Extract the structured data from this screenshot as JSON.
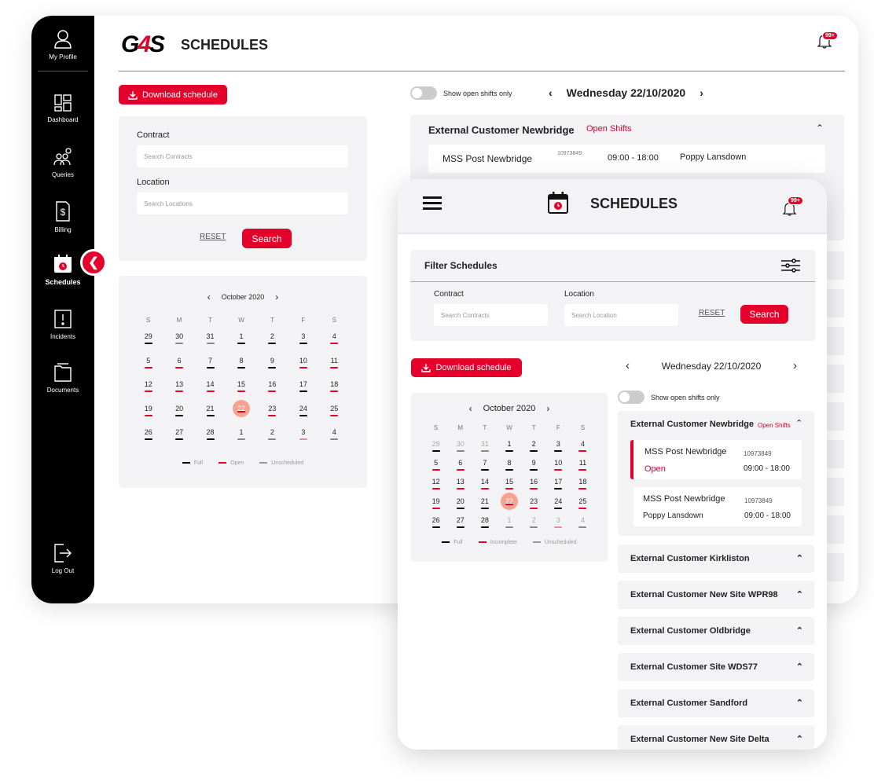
{
  "desktop": {
    "logo": "G4S",
    "title": "SCHEDULES",
    "notif_badge": "99+",
    "sidebar": [
      {
        "label": "My Profile",
        "icon": "profile-icon"
      },
      {
        "label": "Dashboard",
        "icon": "dashboard-icon"
      },
      {
        "label": "Queries",
        "icon": "queries-icon"
      },
      {
        "label": "Billing",
        "icon": "billing-icon"
      },
      {
        "label": "Schedules",
        "icon": "schedules-icon",
        "active": true
      },
      {
        "label": "Incidents",
        "icon": "incidents-icon"
      },
      {
        "label": "Documents",
        "icon": "documents-icon"
      },
      {
        "label": "Log Out",
        "icon": "logout-icon"
      }
    ],
    "collapse_icon": "chevron-left-icon",
    "download_label": "Download schedule",
    "filters": {
      "contract_label": "Contract",
      "contract_placeholder": "Search Contracts",
      "location_label": "Location",
      "location_placeholder": "Search Locations",
      "reset_label": "RESET",
      "search_label": "Search"
    },
    "calendar": {
      "month": "October 2020",
      "dow": [
        "S",
        "M",
        "T",
        "W",
        "T",
        "F",
        "S"
      ],
      "legend": [
        "Full",
        "Open",
        "Unscheduled"
      ]
    },
    "toggle_label": "Show open shifts only",
    "date": "Wednesday 22/10/2020",
    "customer": {
      "name": "External Customer Newbridge",
      "tag": "Open Shifts",
      "shift": {
        "site": "MSS Post Newbridge",
        "id": "10973849",
        "time": "09:00 - 18:00",
        "person": "Poppy Lansdown"
      }
    }
  },
  "mobile": {
    "title": "SCHEDULES",
    "notif_badge": "99+",
    "filter_title": "Filter Schedules",
    "contract_label": "Contract",
    "contract_placeholder": "Search Contracts",
    "location_label": "Location",
    "location_placeholder": "Search Location",
    "reset_label": "RESET",
    "search_label": "Search",
    "download_label": "Download schedule",
    "date": "Wednesday 22/10/2020",
    "toggle_label": "Show open shifts only",
    "calendar": {
      "month": "October 2020",
      "dow": [
        "S",
        "M",
        "T",
        "W",
        "T",
        "F",
        "S"
      ],
      "legend": [
        "Full",
        "Incomplete",
        "Unscheduled"
      ]
    },
    "customer": {
      "name": "External Customer Newbridge",
      "tag": "Open Shifts",
      "shifts": [
        {
          "site": "MSS Post Newbridge",
          "id": "10973849",
          "status": "Open",
          "time": "09:00 - 18:00"
        },
        {
          "site": "MSS Post Newbridge",
          "id": "10973849",
          "status": "Poppy Lansdown",
          "time": "09:00 - 18:00"
        }
      ]
    },
    "customers": [
      "External Customer Kirkliston",
      "External Customer New Site WPR98",
      "External Customer Oldbridge",
      "External Customer Site WDS77",
      "External Customer Sandford",
      "External Customer New Site Delta"
    ]
  },
  "calendar_days": [
    {
      "d": "29",
      "s": "full"
    },
    {
      "d": "30",
      "s": "uns"
    },
    {
      "d": "31",
      "s": "uns"
    },
    {
      "d": "1",
      "s": "full"
    },
    {
      "d": "2",
      "s": "full"
    },
    {
      "d": "3",
      "s": "full"
    },
    {
      "d": "4",
      "s": "open"
    },
    {
      "d": "5",
      "s": "open"
    },
    {
      "d": "6",
      "s": "open"
    },
    {
      "d": "7",
      "s": "full"
    },
    {
      "d": "8",
      "s": "full"
    },
    {
      "d": "9",
      "s": "full"
    },
    {
      "d": "10",
      "s": "open"
    },
    {
      "d": "11",
      "s": "open"
    },
    {
      "d": "12",
      "s": "open"
    },
    {
      "d": "13",
      "s": "open"
    },
    {
      "d": "14",
      "s": "open"
    },
    {
      "d": "15",
      "s": "open"
    },
    {
      "d": "16",
      "s": "open"
    },
    {
      "d": "17",
      "s": "full"
    },
    {
      "d": "18",
      "s": "open"
    },
    {
      "d": "19",
      "s": "open"
    },
    {
      "d": "20",
      "s": "full"
    },
    {
      "d": "21",
      "s": "full"
    },
    {
      "d": "22",
      "s": "today"
    },
    {
      "d": "23",
      "s": "open"
    },
    {
      "d": "24",
      "s": "full"
    },
    {
      "d": "25",
      "s": "open"
    },
    {
      "d": "26",
      "s": "full"
    },
    {
      "d": "27",
      "s": "full"
    },
    {
      "d": "28",
      "s": "full"
    },
    {
      "d": "1",
      "s": "uns"
    },
    {
      "d": "2",
      "s": "uns"
    },
    {
      "d": "3",
      "s": "pink"
    },
    {
      "d": "4",
      "s": "uns"
    }
  ]
}
